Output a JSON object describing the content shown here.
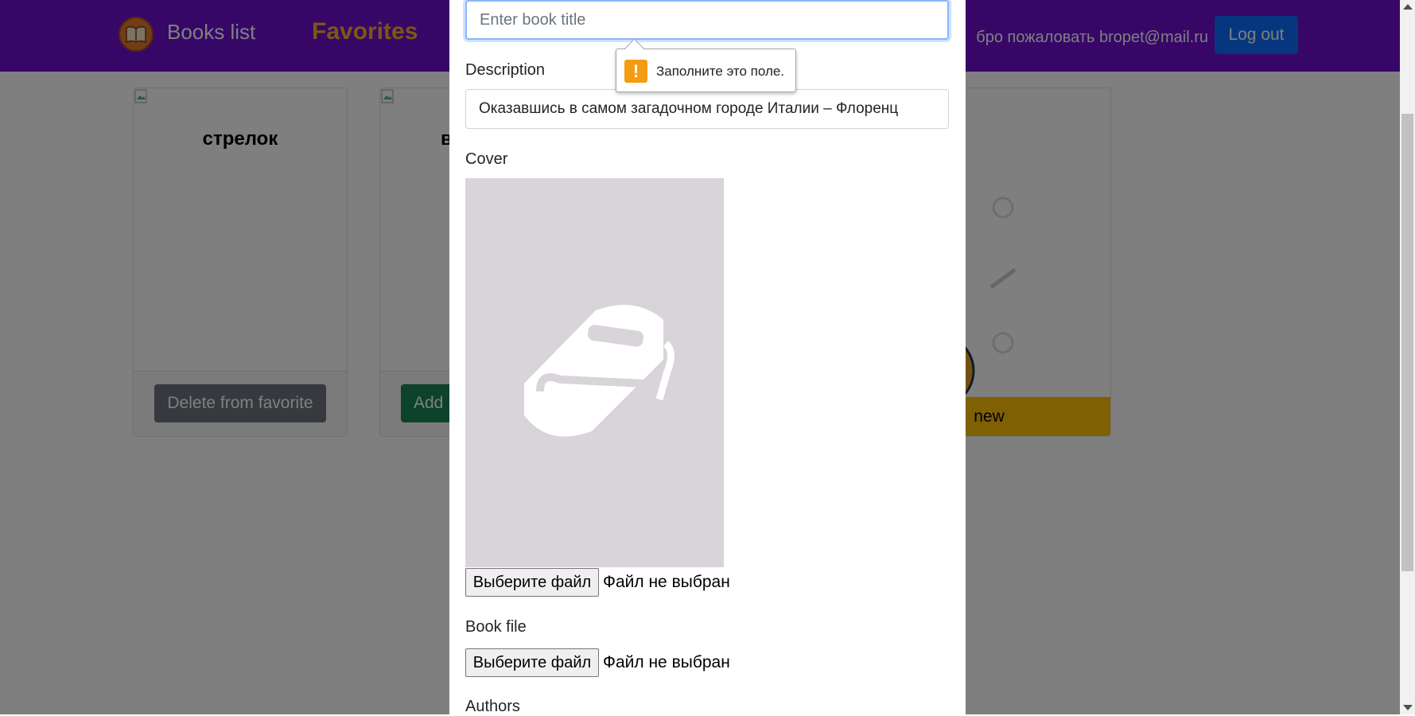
{
  "navbar": {
    "books_link": "Books list",
    "favorites_link": "Favorites",
    "welcome_text": "бро пожаловать bropet@mail.ru",
    "logout_label": "Log out"
  },
  "cards": [
    {
      "title": "стрелок",
      "button": "Delete from favorite"
    },
    {
      "title": "в",
      "button": "Add"
    },
    {
      "button": "new"
    }
  ],
  "modal": {
    "title_placeholder": "Enter book title",
    "description_label": "Description",
    "description_value": "Оказавшись в самом загадочном городе Италии – Флоренц",
    "cover_label": "Cover",
    "cover_button": "Выберите файл",
    "cover_status": "Файл не выбран",
    "book_file_label": "Book file",
    "book_file_button": "Выберите файл",
    "book_file_status": "Файл не выбран",
    "authors_label": "Authors"
  },
  "validation_tooltip": {
    "icon": "warning-icon",
    "message": "Заполните это поле."
  },
  "colors": {
    "navbar": "#6f0fd1",
    "favorites_accent": "#f2b322",
    "logout": "#0d6efd",
    "delete_button": "#6c757d",
    "add_button": "#198754",
    "new_button": "#ffc107"
  }
}
